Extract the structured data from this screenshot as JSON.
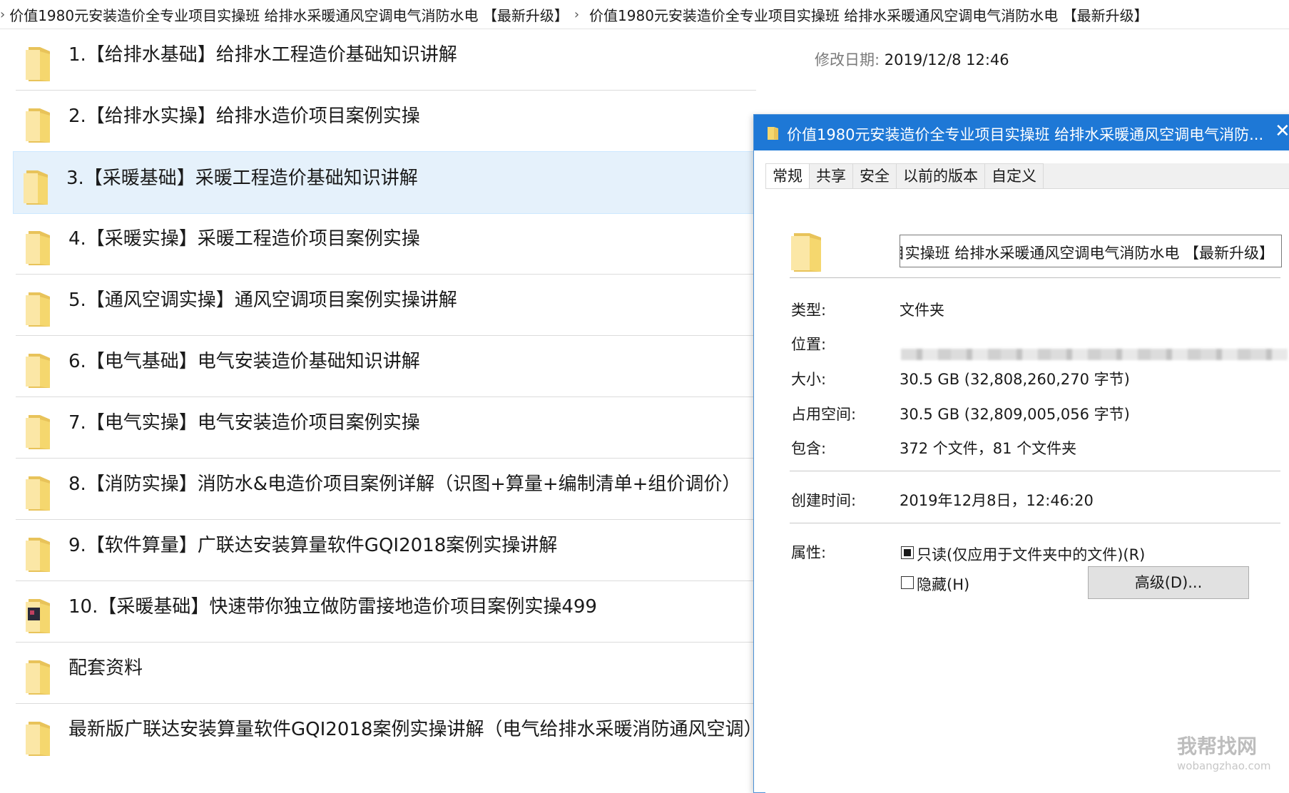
{
  "breadcrumb": {
    "lead": "›",
    "items": [
      "价值1980元安装造价全专业项目实操班 给排水采暖通风空调电气消防水电 【最新升级】",
      "价值1980元安装造价全专业项目实操班 给排水采暖通风空调电气消防水电 【最新升级】"
    ],
    "separator": "›"
  },
  "files": [
    {
      "name": "1.【给排水基础】给排水工程造价基础知识讲解",
      "meta_label": "修改日期:",
      "meta_value": "2019/12/8 12:46"
    },
    {
      "name": "2.【给排水实操】给排水造价项目案例实操"
    },
    {
      "name": "3.【采暖基础】采暖工程造价基础知识讲解"
    },
    {
      "name": "4.【采暖实操】采暖工程造价项目案例实操"
    },
    {
      "name": "5.【通风空调实操】通风空调项目案例实操讲解"
    },
    {
      "name": "6.【电气基础】电气安装造价基础知识讲解"
    },
    {
      "name": "7.【电气实操】电气安装造价项目案例实操"
    },
    {
      "name": "8.【消防实操】消防水&电造价项目案例详解（识图+算量+编制清单+组价调价）"
    },
    {
      "name": "9.【软件算量】广联达安装算量软件GQI2018案例实操讲解"
    },
    {
      "name": "10.【采暖基础】快速带你独立做防雷接地造价项目案例实操499"
    },
    {
      "name": "配套资料"
    },
    {
      "name": "最新版广联达安装算量软件GQI2018案例实操讲解（电气给排水采暖消防通风空调）"
    }
  ],
  "selected_index": 2,
  "dialog": {
    "title": "价值1980元安装造价全专业项目实操班 给排水采暖通风空调电气消防...",
    "close": "✕",
    "tabs": [
      "常规",
      "共享",
      "安全",
      "以前的版本",
      "自定义"
    ],
    "name_field": "目实操班 给排水采暖通风空调电气消防水电 【最新升级】",
    "props": {
      "type_label": "类型:",
      "type_value": "文件夹",
      "location_label": "位置:",
      "size_label": "大小:",
      "size_value": "30.5 GB (32,808,260,270 字节)",
      "disk_label": "占用空间:",
      "disk_value": "30.5 GB (32,809,005,056 字节)",
      "contains_label": "包含:",
      "contains_value": "372 个文件，81 个文件夹",
      "created_label": "创建时间:",
      "created_value": "2019年12月8日，12:46:20",
      "attrs_label": "属性:",
      "readonly_label": "只读(仅应用于文件夹中的文件)(R)",
      "hidden_label": "隐藏(H)",
      "advanced_button": "高级(D)..."
    }
  },
  "watermark": {
    "line1": "我帮找网",
    "line2": "wobangzhao.com"
  },
  "colors": {
    "accent": "#1e78d6",
    "selected_bg": "#e5f1fb",
    "folder": "#f5d76e"
  }
}
